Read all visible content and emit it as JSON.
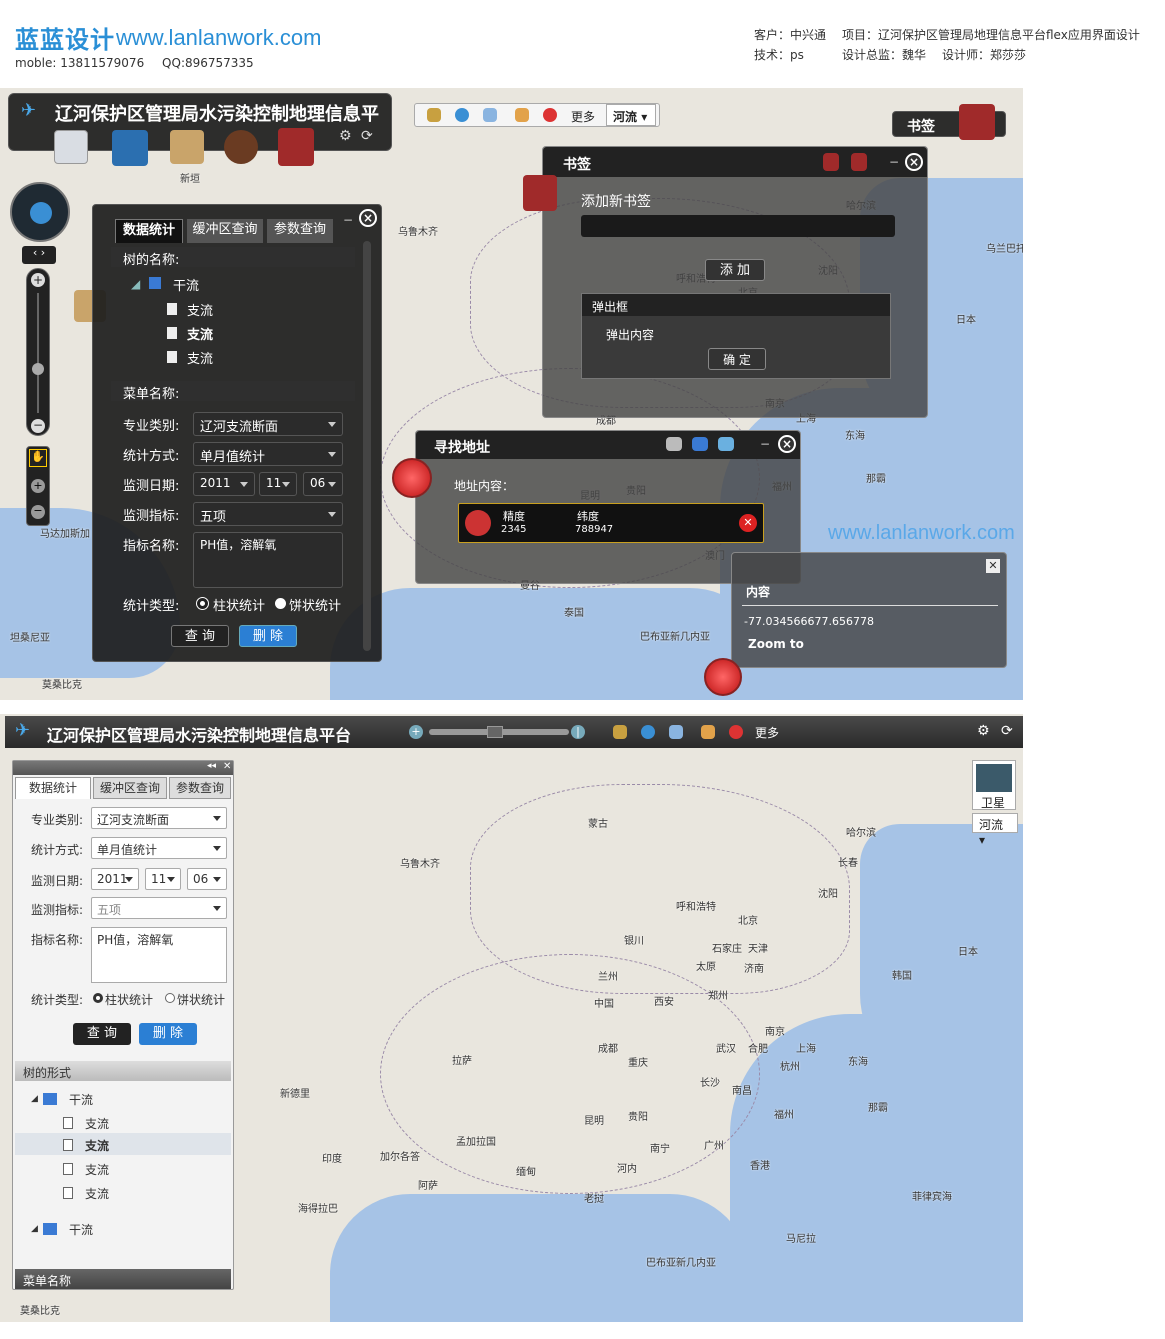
{
  "header": {
    "logo_cn": "蓝蓝设计",
    "logo_url": "www.lanlanwork.com",
    "mobile": "moble: 13811579076",
    "qq": "QQ:896757335",
    "client": "客户：中兴通",
    "project": "项目：辽河保护区管理局地理信息平台flex应用界面设计",
    "tech": "技术：ps",
    "director": "设计总监：魏华",
    "designer": "设计师：郑莎莎"
  },
  "app": {
    "title": "辽河保护区管理局水污染控制地理信息平台",
    "toolbar_more": "更多",
    "map_type": "河流",
    "bookmark_label": "书签",
    "satellite": "卫星"
  },
  "stats_panel": {
    "tabs": [
      "数据统计",
      "缓冲区查询",
      "参数查询"
    ],
    "tree_header": "树的名称:",
    "tree_root": "干流",
    "tree_children": [
      "支流",
      "支流",
      "支流"
    ],
    "menu_header": "菜单名称:",
    "category_label": "专业类别:",
    "category_value": "辽河支流断面",
    "method_label": "统计方式:",
    "method_value": "单月值统计",
    "date_label": "监测日期:",
    "year": "2011",
    "month": "11",
    "day": "06",
    "index_label": "监测指标:",
    "index_value": "五项",
    "name_label": "指标名称:",
    "name_value": "PH值，溶解氧",
    "type_label": "统计类型:",
    "type_bar": "柱状统计",
    "type_pie": "饼状统计",
    "query_btn": "查 询",
    "delete_btn": "删 除"
  },
  "bookmark_panel": {
    "title": "书签",
    "add_label": "添加新书签",
    "add_btn": "添 加",
    "popup_title": "弹出框",
    "popup_content": "弹出内容",
    "ok_btn": "确 定"
  },
  "address_panel": {
    "title": "寻找地址",
    "label": "地址内容：",
    "col_lng": "精度",
    "col_lat": "纬度",
    "lng": "2345",
    "lat": "788947"
  },
  "info_popup": {
    "title": "内容",
    "coords": "-77.034566677.656778",
    "zoom": "Zoom to"
  },
  "watermark": "www.lanlanwork.com",
  "light_panel": {
    "tabs": [
      "数据统计",
      "缓冲区查询",
      "参数查询"
    ],
    "tree_section": "树的形式",
    "tree_root": "干流",
    "tree_children": [
      "支流",
      "支流",
      "支流",
      "支流"
    ],
    "tree_root2": "干流",
    "menu_section": "菜单名称"
  },
  "map_labels_top": [
    [
      "乌鲁木齐",
      398,
      223
    ],
    [
      "哈尔滨",
      846,
      197
    ],
    [
      "沈阳",
      818,
      262
    ],
    [
      "呼和浩特",
      676,
      270
    ],
    [
      "北京",
      738,
      284
    ],
    [
      "日本",
      956,
      311
    ],
    [
      "成都",
      596,
      412
    ],
    [
      "南京",
      765,
      395
    ],
    [
      "上海",
      796,
      410
    ],
    [
      "东海",
      845,
      427
    ],
    [
      "昆明",
      580,
      487
    ],
    [
      "贵阳",
      626,
      482
    ],
    [
      "福州",
      772,
      478
    ],
    [
      "那霸",
      866,
      470
    ],
    [
      "澳门",
      705,
      547
    ],
    [
      "曼谷",
      520,
      577
    ],
    [
      "泰国",
      564,
      604
    ],
    [
      "巴布亚新几内亚",
      640,
      628
    ],
    [
      "乌兰巴托",
      986,
      240
    ],
    [
      "莫桑比克",
      42,
      676
    ],
    [
      "坦桑尼亚",
      10,
      629
    ],
    [
      "新垣",
      180,
      170
    ],
    [
      "马达加斯加",
      40,
      525
    ]
  ],
  "map_labels_bottom": [
    [
      "蒙古",
      588,
      815
    ],
    [
      "哈尔滨",
      846,
      824
    ],
    [
      "长春",
      838,
      854
    ],
    [
      "乌鲁木齐",
      400,
      855
    ],
    [
      "沈阳",
      818,
      885
    ],
    [
      "呼和浩特",
      676,
      898
    ],
    [
      "北京",
      738,
      912
    ],
    [
      "天津",
      748,
      940
    ],
    [
      "石家庄",
      712,
      940
    ],
    [
      "太原",
      696,
      958
    ],
    [
      "济南",
      744,
      960
    ],
    [
      "银川",
      624,
      932
    ],
    [
      "兰州",
      598,
      968
    ],
    [
      "中国",
      594,
      995
    ],
    [
      "西安",
      654,
      993
    ],
    [
      "郑州",
      708,
      987
    ],
    [
      "南京",
      765,
      1023
    ],
    [
      "上海",
      796,
      1040
    ],
    [
      "成都",
      598,
      1040
    ],
    [
      "武汉",
      716,
      1040
    ],
    [
      "合肥",
      748,
      1040
    ],
    [
      "重庆",
      628,
      1054
    ],
    [
      "长沙",
      700,
      1074
    ],
    [
      "南昌",
      732,
      1082
    ],
    [
      "杭州",
      780,
      1058
    ],
    [
      "东海",
      848,
      1053
    ],
    [
      "拉萨",
      452,
      1052
    ],
    [
      "贵阳",
      628,
      1108
    ],
    [
      "昆明",
      584,
      1112
    ],
    [
      "福州",
      774,
      1106
    ],
    [
      "那霸",
      868,
      1099
    ],
    [
      "广州",
      704,
      1137
    ],
    [
      "南宁",
      650,
      1140
    ],
    [
      "香港",
      750,
      1157
    ],
    [
      "河内",
      617,
      1160
    ],
    [
      "缅甸",
      516,
      1163
    ],
    [
      "老挝",
      584,
      1190
    ],
    [
      "菲律宾海",
      912,
      1188
    ],
    [
      "马尼拉",
      786,
      1230
    ],
    [
      "巴布亚新几内亚",
      646,
      1254
    ],
    [
      "日本",
      958,
      943
    ],
    [
      "韩国",
      892,
      967
    ],
    [
      "新德里",
      280,
      1085
    ],
    [
      "加尔各答",
      380,
      1148
    ],
    [
      "孟加拉国",
      456,
      1133
    ],
    [
      "印度",
      322,
      1150
    ],
    [
      "阿萨",
      418,
      1177
    ],
    [
      "海得拉巴",
      298,
      1200
    ],
    [
      "莫桑比克",
      20,
      1302
    ]
  ]
}
